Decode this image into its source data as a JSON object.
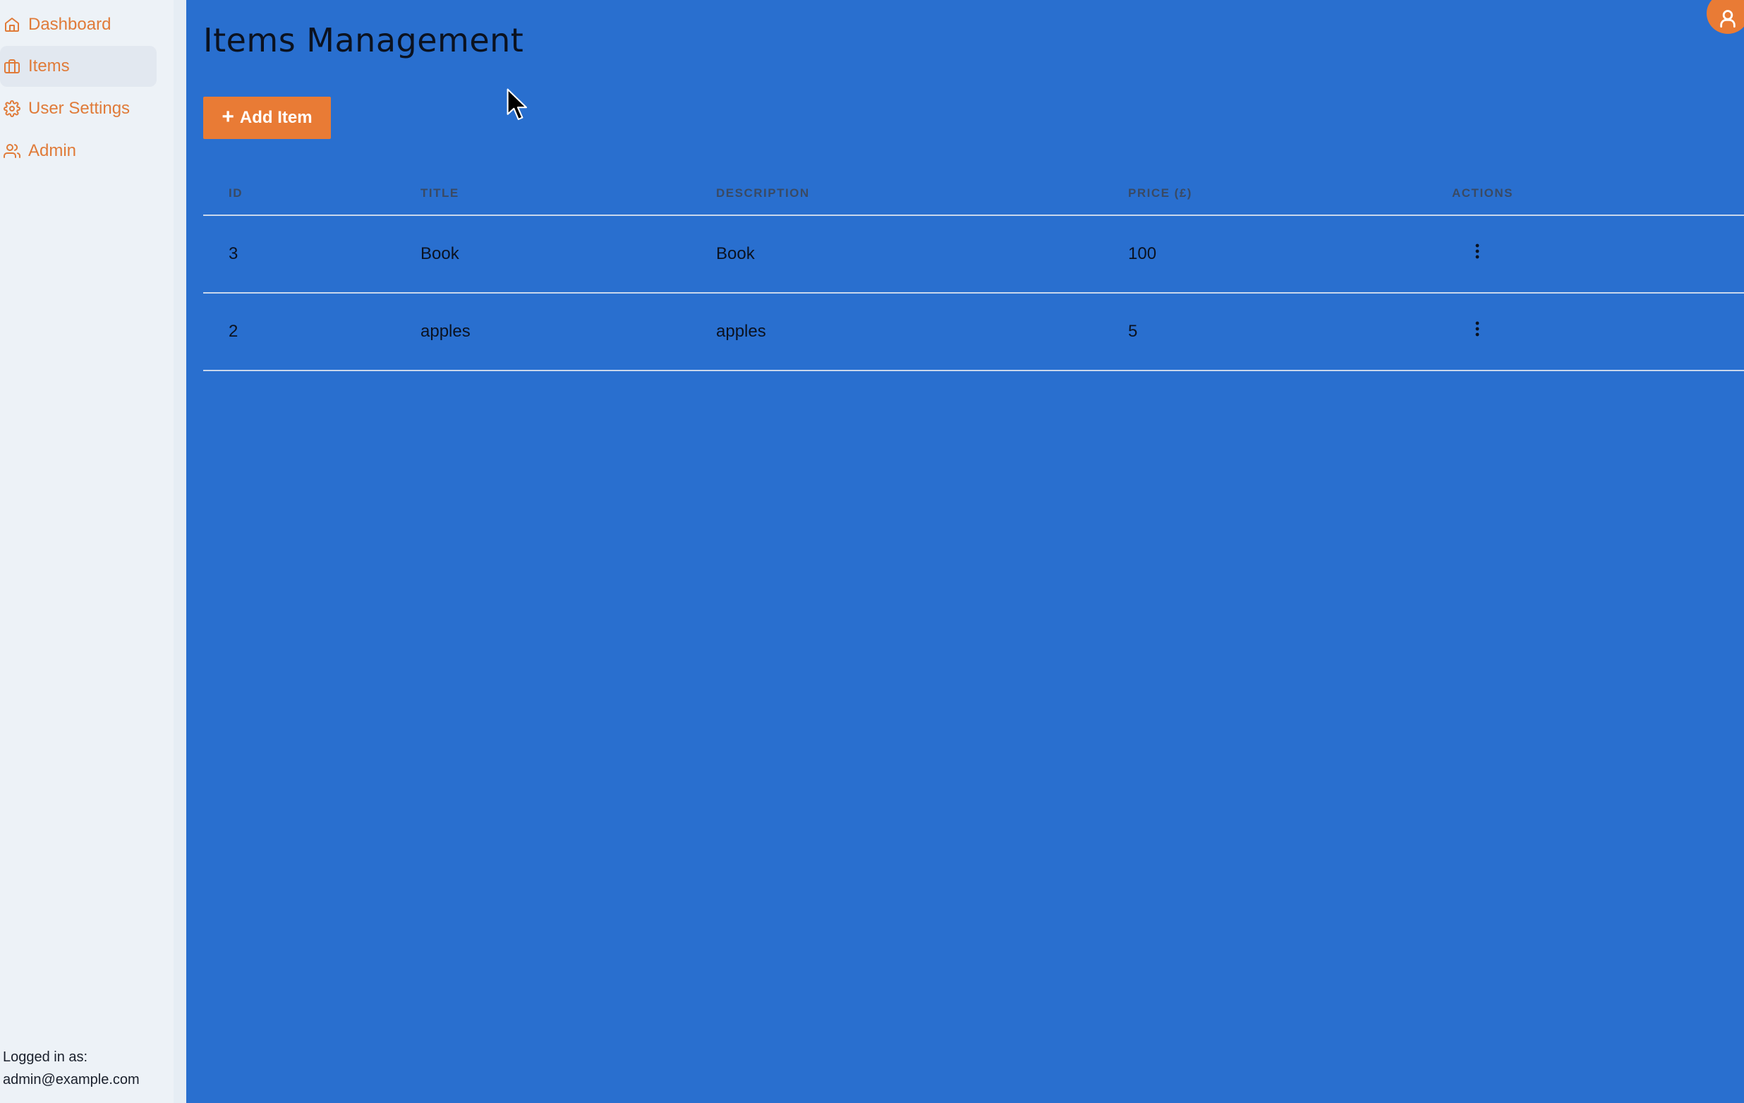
{
  "sidebar": {
    "items": [
      {
        "label": "Dashboard",
        "icon": "home-icon"
      },
      {
        "label": "Items",
        "icon": "briefcase-icon",
        "active": true
      },
      {
        "label": "User Settings",
        "icon": "settings-icon"
      },
      {
        "label": "Admin",
        "icon": "users-icon"
      }
    ],
    "logged_in_label": "Logged in as:",
    "logged_in_email": "admin@example.com"
  },
  "main": {
    "title": "Items Management",
    "add_button_label": "Add Item",
    "table": {
      "headers": [
        "ID",
        "TITLE",
        "DESCRIPTION",
        "PRICE (£)",
        "ACTIONS"
      ],
      "rows": [
        {
          "id": "3",
          "title": "Book",
          "description": "Book",
          "price": "100"
        },
        {
          "id": "2",
          "title": "apples",
          "description": "apples",
          "price": "5"
        }
      ]
    }
  },
  "colors": {
    "main_background": "#296fcf",
    "sidebar_background": "#edf2f7",
    "accent": "#e97b35",
    "text": "#0b1220"
  },
  "icons": {
    "user_menu": "user-icon",
    "row_actions": "more-vertical-icon",
    "add": "plus-icon"
  }
}
